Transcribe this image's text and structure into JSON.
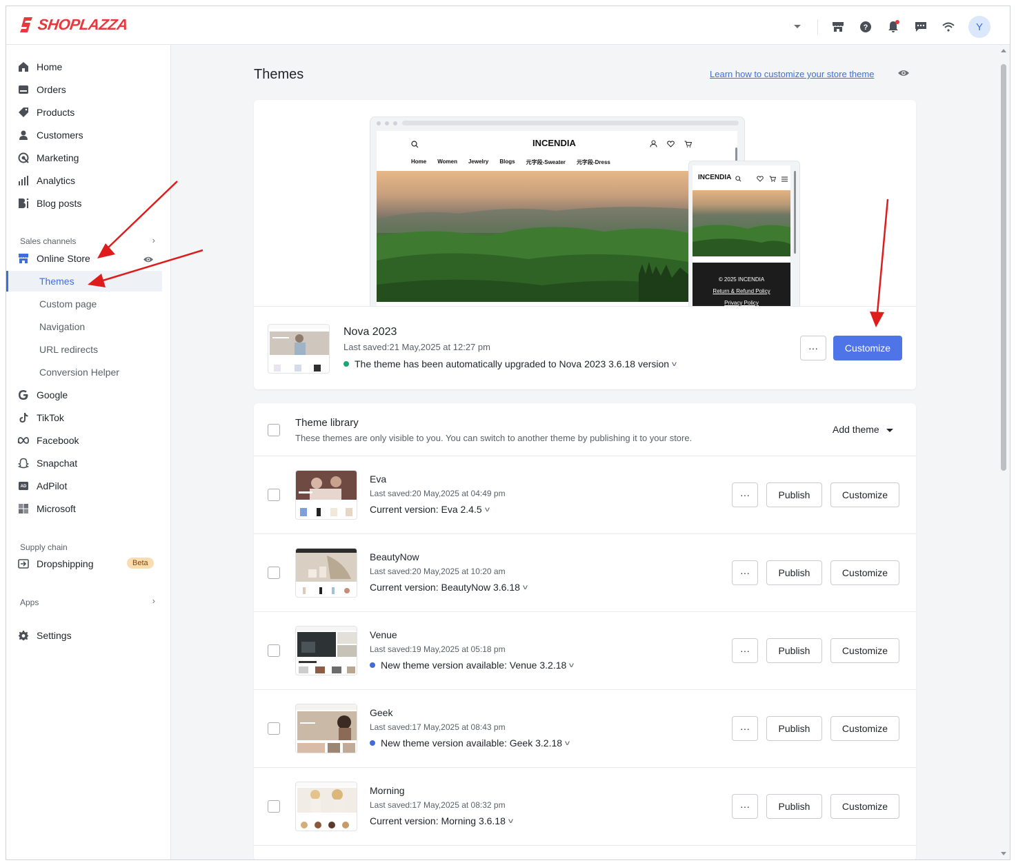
{
  "brand": {
    "name": "SHOPLAZZA",
    "color": "#e8383d"
  },
  "topbar": {
    "avatar_letter": "Y",
    "icons": [
      "dropdown-icon",
      "store-icon",
      "help-icon",
      "bell-icon",
      "message-icon",
      "wifi-icon"
    ]
  },
  "sidebar": {
    "items": [
      {
        "label": "Home",
        "icon": "home-icon"
      },
      {
        "label": "Orders",
        "icon": "orders-icon"
      },
      {
        "label": "Products",
        "icon": "tag-icon"
      },
      {
        "label": "Customers",
        "icon": "person-icon"
      },
      {
        "label": "Marketing",
        "icon": "marketing-icon"
      },
      {
        "label": "Analytics",
        "icon": "analytics-icon"
      },
      {
        "label": "Blog posts",
        "icon": "blog-icon"
      }
    ],
    "sales_channels_label": "Sales channels",
    "online_store": "Online Store",
    "sub_items": [
      "Themes",
      "Custom page",
      "Navigation",
      "URL redirects",
      "Conversion Helper"
    ],
    "channels": [
      {
        "label": "Google",
        "icon": "google-icon"
      },
      {
        "label": "TikTok",
        "icon": "tiktok-icon"
      },
      {
        "label": "Facebook",
        "icon": "meta-icon"
      },
      {
        "label": "Snapchat",
        "icon": "snapchat-icon"
      },
      {
        "label": "AdPilot",
        "icon": "adpilot-icon"
      },
      {
        "label": "Microsoft",
        "icon": "microsoft-icon"
      }
    ],
    "supply_chain_label": "Supply chain",
    "dropshipping": "Dropshipping",
    "beta": "Beta",
    "apps_label": "Apps",
    "settings": "Settings"
  },
  "main": {
    "title": "Themes",
    "learn_link": "Learn how to customize your store theme",
    "preview": {
      "brand": "INCENDIA",
      "menu": [
        "Home",
        "Women",
        "Jewelry",
        "Blogs",
        "元字段-Sweater",
        "元字段-Dress"
      ],
      "footer_copyright": "© 2025 INCENDIA",
      "footer_refund": "Return & Refund Policy",
      "footer_privacy": "Privacy Policy"
    },
    "current_theme": {
      "name": "Nova 2023",
      "saved": "Last saved:21 May,2025 at 12:27 pm",
      "status": "The theme has been automatically upgraded to Nova 2023 3.6.18 version",
      "more": "···",
      "customize": "Customize"
    },
    "library": {
      "title": "Theme library",
      "subtitle": "These themes are only visible to you. You can switch to another theme by publishing it to your store.",
      "add_theme": "Add theme",
      "publish_label": "Publish",
      "customize_label": "Customize",
      "more_label": "···",
      "themes": [
        {
          "name": "Eva",
          "saved": "Last saved:20 May,2025 at 04:49 pm",
          "version": "Current version: Eva 2.4.5",
          "update": false
        },
        {
          "name": "BeautyNow",
          "saved": "Last saved:20 May,2025 at 10:20 am",
          "version": "Current version: BeautyNow 3.6.18",
          "update": false
        },
        {
          "name": "Venue",
          "saved": "Last saved:19 May,2025 at 05:18 pm",
          "version": "New theme version available: Venue 3.2.18",
          "update": true
        },
        {
          "name": "Geek",
          "saved": "Last saved:17 May,2025 at 08:43 pm",
          "version": "New theme version available: Geek 3.2.18",
          "update": true
        },
        {
          "name": "Morning",
          "saved": "Last saved:17 May,2025 at 08:32 pm",
          "version": "Current version: Morning 3.6.18",
          "update": false
        }
      ]
    }
  },
  "colors": {
    "accent": "#4f74e8",
    "link": "#3f6ed8",
    "success": "#1aa672",
    "annotation": "#e01b1b"
  }
}
